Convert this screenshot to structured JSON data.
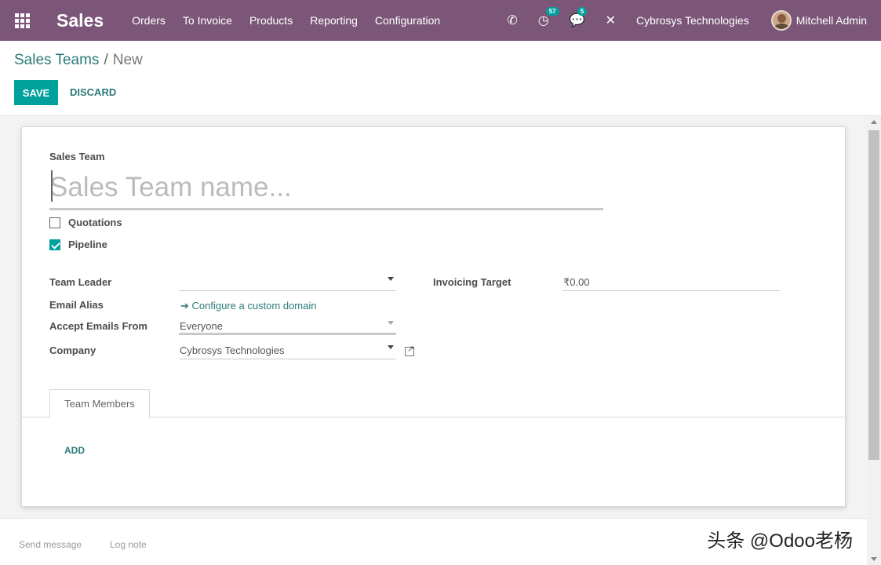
{
  "navbar": {
    "brand": "Sales",
    "menu": [
      "Orders",
      "To Invoice",
      "Products",
      "Reporting",
      "Configuration"
    ],
    "activity_count": "57",
    "message_count": "5",
    "company": "Cybrosys Technologies",
    "user": "Mitchell Admin"
  },
  "control_panel": {
    "breadcrumb_parent": "Sales Teams",
    "breadcrumb_separator": "/",
    "breadcrumb_current": "New",
    "save_label": "SAVE",
    "discard_label": "DISCARD"
  },
  "form": {
    "team_label": "Sales Team",
    "name_placeholder": "Sales Team name...",
    "quotations_label": "Quotations",
    "quotations_checked": false,
    "pipeline_label": "Pipeline",
    "pipeline_checked": true,
    "team_leader_label": "Team Leader",
    "team_leader_value": "",
    "email_alias_label": "Email Alias",
    "email_alias_link": "Configure a custom domain",
    "accept_emails_label": "Accept Emails From",
    "accept_emails_value": "Everyone",
    "company_label": "Company",
    "company_value": "Cybrosys Technologies",
    "invoicing_target_label": "Invoicing Target",
    "invoicing_target_value": "₹0.00",
    "tab_team_members": "Team Members",
    "add_label": "ADD"
  },
  "chatter": {
    "send_message": "Send message",
    "log_note": "Log note"
  },
  "watermark": "头条 @Odoo老杨",
  "colors": {
    "navbar": "#7c5679",
    "accent": "#00a09d",
    "link": "#2b7a78"
  }
}
